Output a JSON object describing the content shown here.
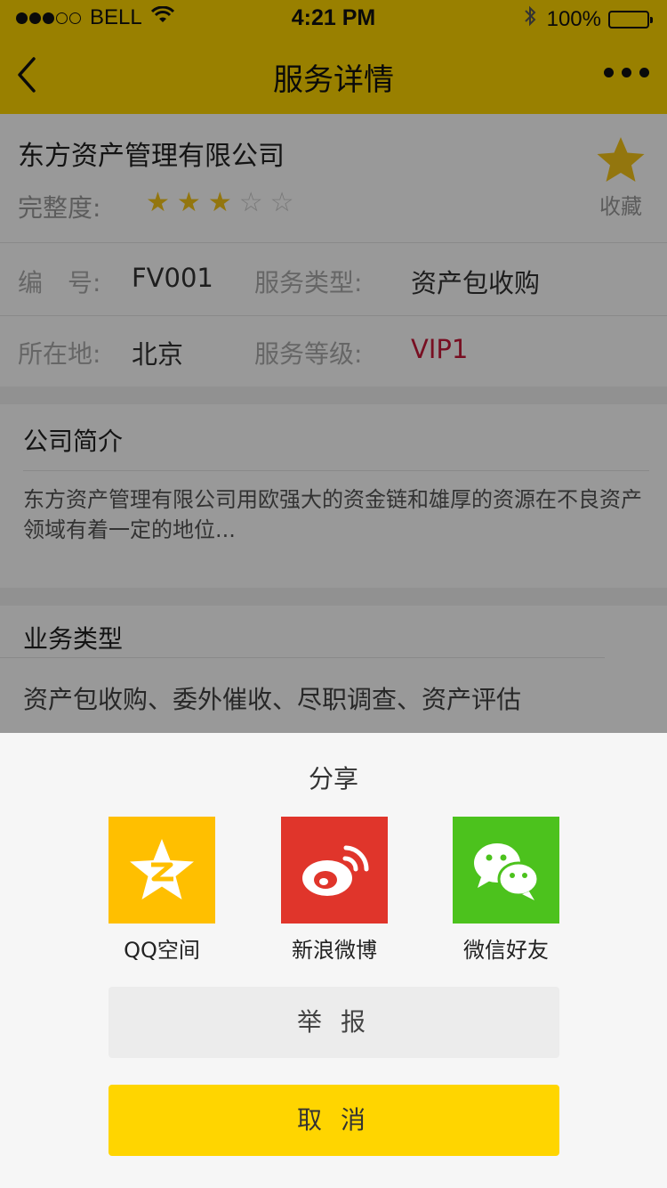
{
  "status_bar": {
    "carrier": "BELL",
    "time": "4:21 PM",
    "battery": "100%",
    "signal_dots": [
      1,
      1,
      1,
      0,
      0
    ]
  },
  "nav": {
    "title": "服务详情",
    "back_icon": "chevron-left-icon",
    "more_icon": "more-dots-icon",
    "bar_color": "#ffd500"
  },
  "company": {
    "name": "东方资产管理有限公司",
    "completeness_label": "完整度:",
    "rating_filled": 3,
    "rating_total": 5,
    "stars": [
      "★",
      "★",
      "★",
      "☆",
      "☆"
    ],
    "favorite_label": "收藏"
  },
  "info": {
    "number_label": "编　号:",
    "number_value": "FV001",
    "service_type_label": "服务类型:",
    "service_type_value": "资产包收购",
    "location_label": "所在地:",
    "location_value": "北京",
    "service_level_label": "服务等级:",
    "service_level_value": "VIP1",
    "vip_color": "#c8193a"
  },
  "intro": {
    "title": "公司简介",
    "text": "东方资产管理有限公司用欧强大的资金链和雄厚的资源在不良资产领域有着一定的地位..."
  },
  "business": {
    "title": "业务类型",
    "text": "资产包收购、委外催收、尽职调查、资产评估"
  },
  "share_sheet": {
    "title": "分享",
    "items": [
      {
        "label": "QQ空间",
        "icon": "qzone-icon",
        "color": "#ffbf00"
      },
      {
        "label": "新浪微博",
        "icon": "weibo-icon",
        "color": "#e0352b"
      },
      {
        "label": "微信好友",
        "icon": "wechat-icon",
        "color": "#4cc21d"
      }
    ],
    "report_label": "举 报",
    "cancel_label": "取 消"
  }
}
